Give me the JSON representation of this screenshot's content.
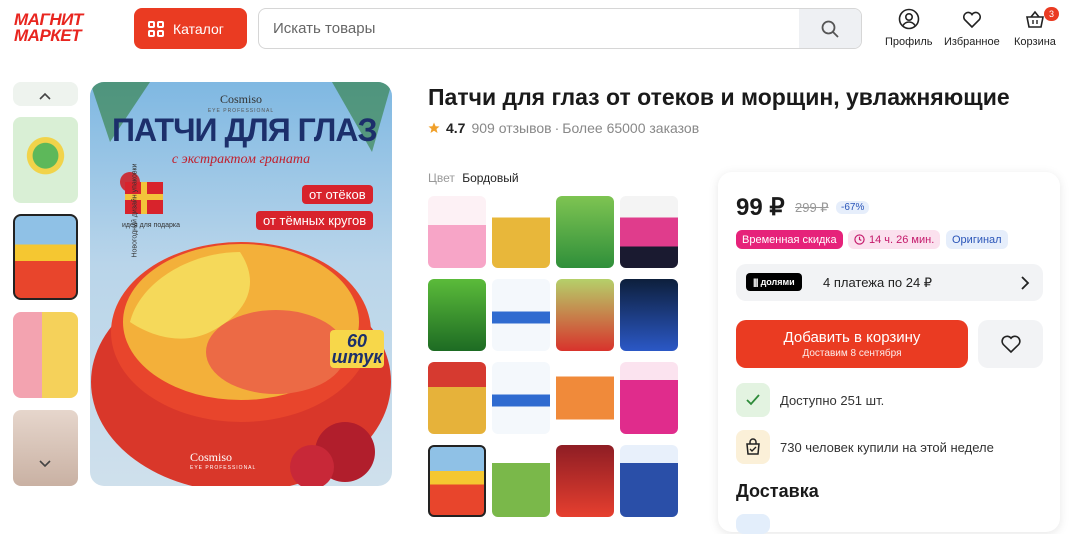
{
  "brand": {
    "line1": "МАГНИТ",
    "line2": "МАРКЕТ"
  },
  "header": {
    "catalog_label": "Каталог",
    "search_placeholder": "Искать товары",
    "profile_label": "Профиль",
    "favorites_label": "Избранное",
    "cart_label": "Корзина",
    "cart_count": "3"
  },
  "gallery": {
    "up_arrow": "^",
    "down_arrow": "⌄",
    "main_image": {
      "brand": "Cosmiso",
      "brand_sub": "EYE PROFESSIONAL",
      "headline": "ПАТЧИ ДЛЯ ГЛАЗ",
      "subline": "с экстрактом граната",
      "tag1": "от отёков",
      "tag2": "от тёмных кругов",
      "gift_text": "Новогодний дизайн упаковки",
      "gift_idea": "идея для подарка",
      "count": "60",
      "count_unit": "штук",
      "bottom_brand": "Cosmiso",
      "bottom_sub": "EYE PROFESSIONAL"
    }
  },
  "product": {
    "title": "Патчи для глаз от отеков и морщин, увлажняющие",
    "rating": "4.7",
    "reviews": "909 отзывов",
    "separator": "·",
    "orders": "Более 65000 заказов",
    "color_label": "Цвет",
    "color_value": "Бордовый"
  },
  "buy": {
    "price": "99 ₽",
    "old_price": "299 ₽",
    "discount": "-67%",
    "tag_sale": "Временная скидка",
    "tag_timer": "14 ч. 26 мин.",
    "tag_original": "Оригинал",
    "dolyami_label": "долями",
    "dolyami_text": "4 платежа по 24 ₽",
    "add_label": "Добавить в корзину",
    "add_sub": "Доставим 8 сентября",
    "stock_text": "Доступно 251 шт.",
    "bought_text": "730 человек купили на этой неделе",
    "delivery_title": "Доставка"
  },
  "colors": {
    "accent": "#ea3b22",
    "pink": "#e6227a",
    "blue": "#2a55b8"
  }
}
